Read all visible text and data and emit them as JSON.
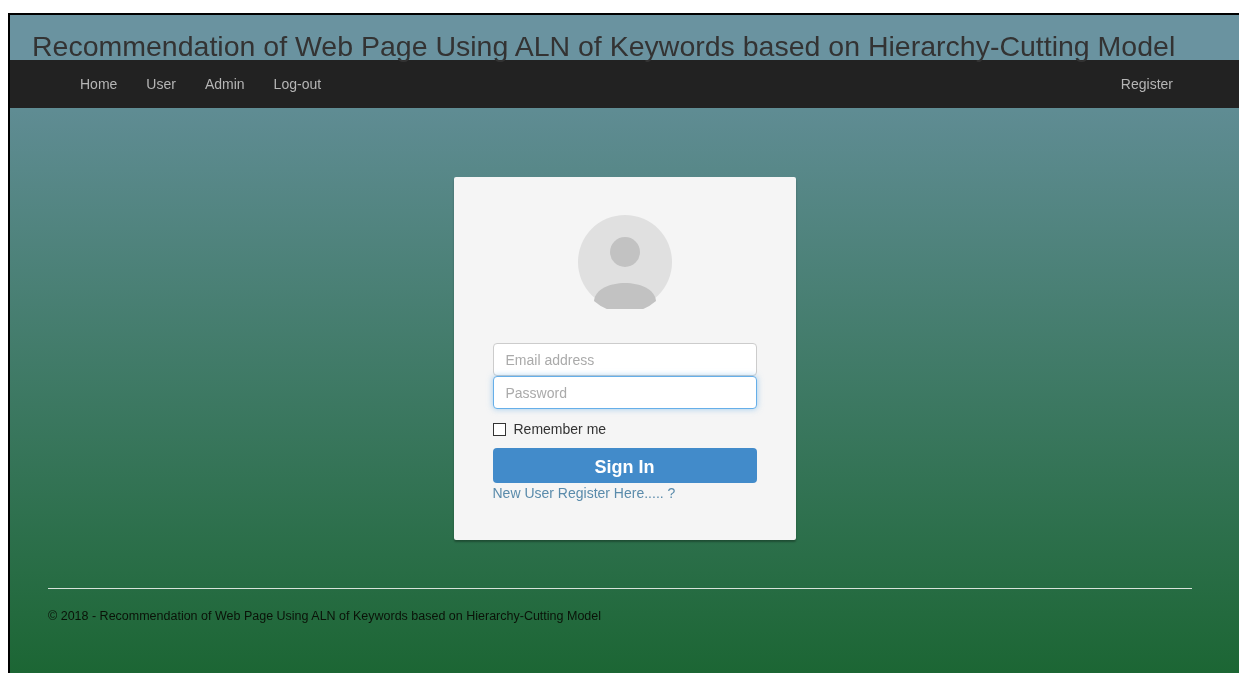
{
  "header": {
    "title": "Recommendation of Web Page Using ALN of Keywords based on Hierarchy-Cutting Model"
  },
  "navbar": {
    "left": [
      "Home",
      "User",
      "Admin",
      "Log-out"
    ],
    "right": [
      "Register"
    ]
  },
  "login": {
    "fields": [
      {
        "placeholder": "Email address",
        "focused": false
      },
      {
        "placeholder": "Password",
        "focused": true
      }
    ],
    "remember": {
      "label": "Remember me",
      "checked": false
    },
    "button": "Sign In",
    "link": "New User Register Here..... ?"
  },
  "footer": {
    "text": "© 2018 - Recommendation of Web Page Using ALN of Keywords based on Hierarchy-Cutting Model"
  }
}
